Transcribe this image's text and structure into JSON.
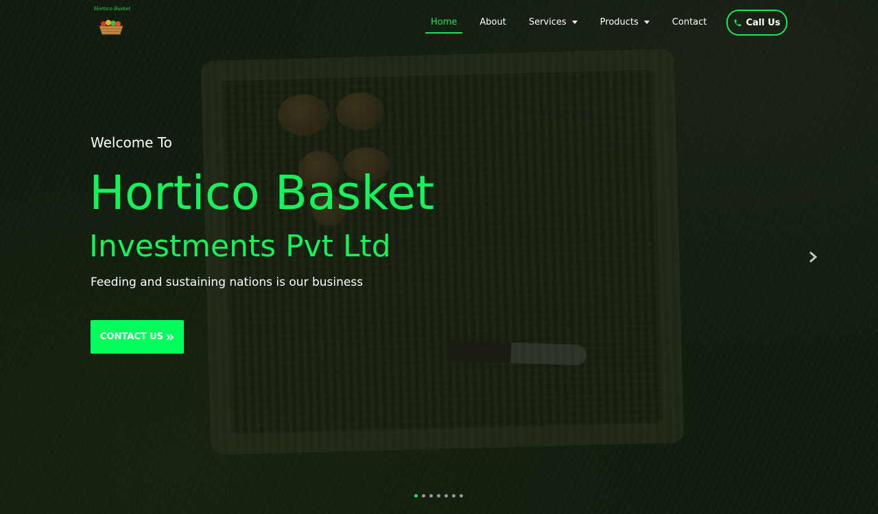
{
  "brand": {
    "logo_text": "Hortico Basket",
    "logo_icon": "basket-logo-icon"
  },
  "nav": {
    "items": [
      {
        "label": "Home",
        "active": true,
        "dropdown": false
      },
      {
        "label": "About",
        "active": false,
        "dropdown": false
      },
      {
        "label": "Services",
        "active": false,
        "dropdown": true
      },
      {
        "label": "Products",
        "active": false,
        "dropdown": true
      },
      {
        "label": "Contact",
        "active": false,
        "dropdown": false
      }
    ],
    "call_label": "Call Us",
    "call_icon": "phone-icon"
  },
  "hero": {
    "welcome": "Welcome To",
    "title": "Hortico Basket",
    "subtitle": "Investments Pvt Ltd",
    "tagline": "Feeding and sustaining nations is our business",
    "cta_label": "CONTACT US",
    "cta_icon": "double-chevron-right-icon"
  },
  "carousel": {
    "next_icon": "chevron-right-icon",
    "slide_count": 7,
    "active_index": 0
  },
  "colors": {
    "accent": "#18f25a",
    "button": "#00ff5a",
    "text": "#ffffff"
  }
}
